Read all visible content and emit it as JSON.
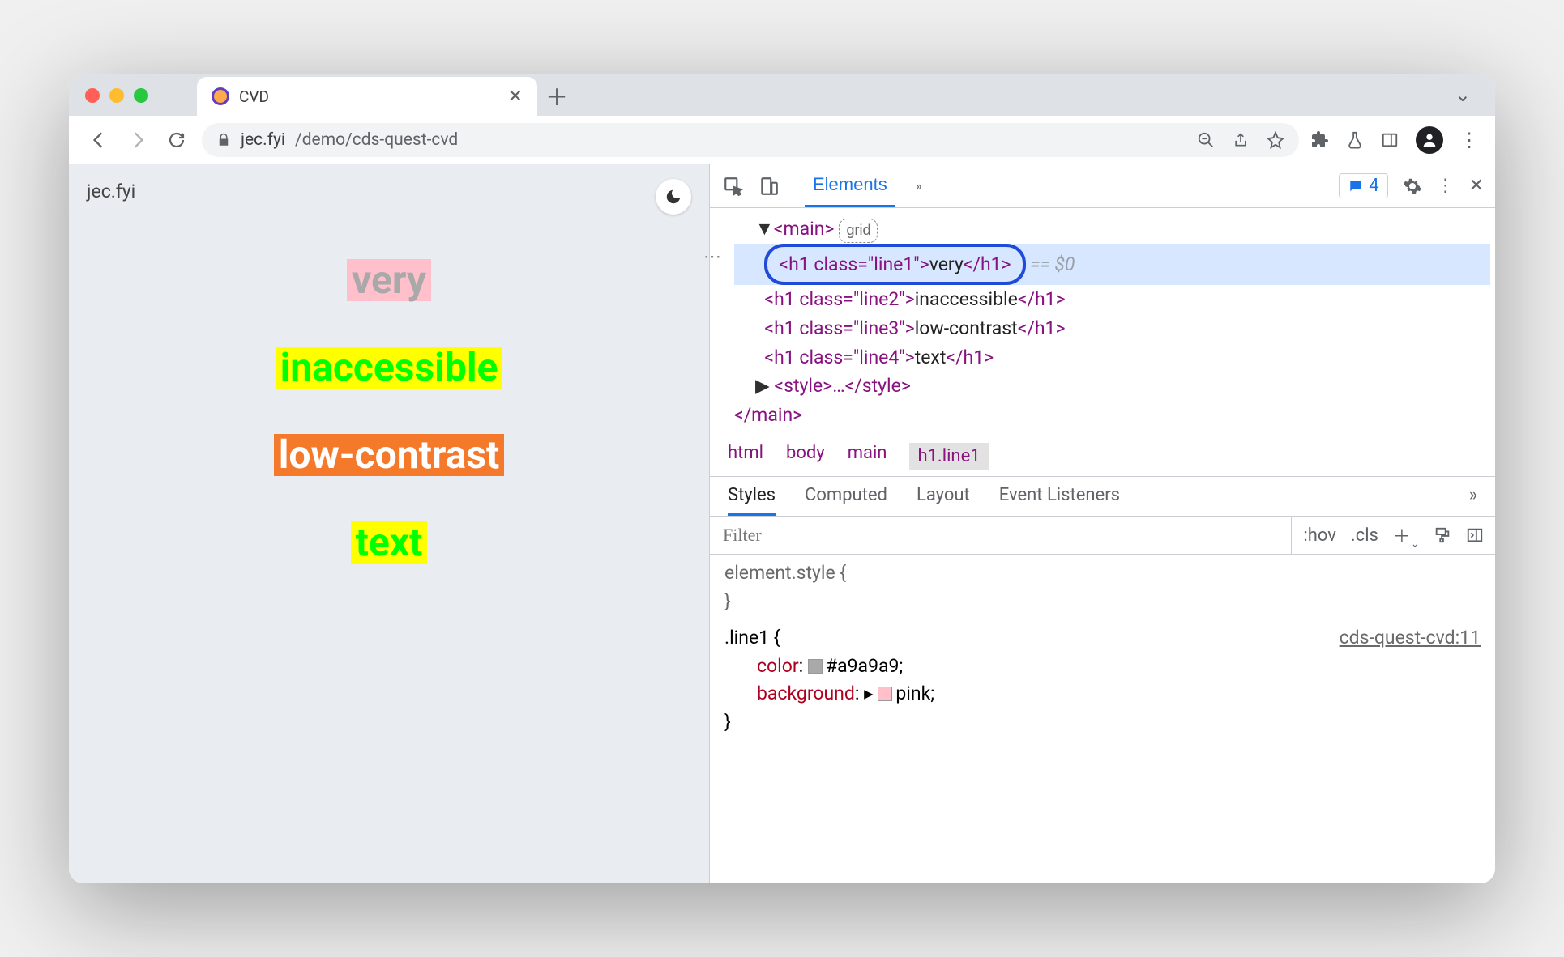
{
  "tab": {
    "title": "CVD"
  },
  "url": {
    "host": "jec.fyi",
    "path": "/demo/cds-quest-cvd"
  },
  "page": {
    "header": "jec.fyi",
    "line1": "very",
    "line2": "inaccessible",
    "line3": "low-contrast",
    "line4": "text"
  },
  "devtools": {
    "panel": "Elements",
    "issues_count": "4",
    "dom": {
      "main_tag_open": "<main>",
      "grid_badge": "grid",
      "h1a_open": "<h1 class=\"line1\">",
      "h1a_text": "very",
      "h1a_close": "</h1>",
      "eq0": " == $0",
      "h1b_open": "<h1 class=\"line2\">",
      "h1b_text": "inaccessible",
      "h1b_close": "</h1>",
      "h1c_open": "<h1 class=\"line3\">",
      "h1c_text": "low-contrast",
      "h1c_close": "</h1>",
      "h1d_open": "<h1 class=\"line4\">",
      "h1d_text": "text",
      "h1d_close": "</h1>",
      "style_collapsed": "<style>…</style>",
      "main_close": "</main>"
    },
    "breadcrumb": [
      "html",
      "body",
      "main",
      "h1.line1"
    ],
    "styles_tabs": [
      "Styles",
      "Computed",
      "Layout",
      "Event Listeners"
    ],
    "filter_placeholder": "Filter",
    "filter_tools": {
      "hov": ":hov",
      "cls": ".cls"
    },
    "styles": {
      "element_style": "element.style {",
      "element_style_close": "}",
      "selector": ".line1 {",
      "src": "cds-quest-cvd:11",
      "prop1_name": "color",
      "prop1_value": "#a9a9a9;",
      "prop1_swatch": "#a9a9a9",
      "prop2_name": "background",
      "prop2_value": "pink;",
      "prop2_swatch": "pink",
      "close": "}"
    }
  }
}
